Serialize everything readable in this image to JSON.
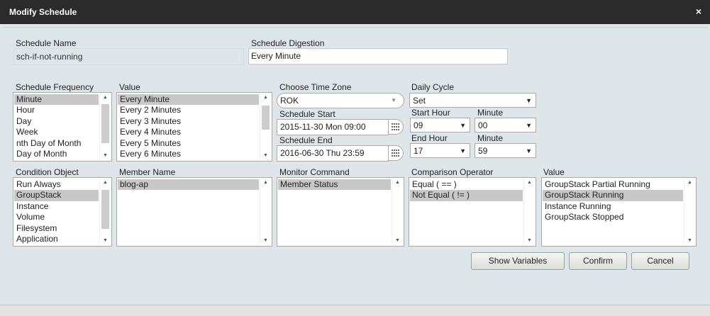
{
  "dialog": {
    "title": "Modify Schedule",
    "close_glyph": "×"
  },
  "schedule_name": {
    "label": "Schedule Name",
    "value": "sch-if-not-running"
  },
  "schedule_digestion": {
    "label": "Schedule Digestion",
    "value": "Every Minute"
  },
  "frequency": {
    "label": "Schedule Frequency",
    "items": [
      "Minute",
      "Hour",
      "Day",
      "Week",
      "nth Day of Month",
      "Day of Month"
    ],
    "selected": 0
  },
  "value_list": {
    "label": "Value",
    "items": [
      "Every Minute",
      "Every 2 Minutes",
      "Every 3 Minutes",
      "Every 4 Minutes",
      "Every 5 Minutes",
      "Every 6 Minutes"
    ],
    "selected": 0
  },
  "time_zone": {
    "label": "Choose Time Zone",
    "value": "ROK"
  },
  "schedule_start": {
    "label": "Schedule Start",
    "value": "2015-11-30 Mon 09:00"
  },
  "schedule_end": {
    "label": "Schedule End",
    "value": "2016-06-30 Thu 23:59"
  },
  "daily_cycle": {
    "label": "Daily Cycle",
    "value": "Set"
  },
  "start_hour": {
    "label": "Start Hour",
    "value": "09"
  },
  "start_minute": {
    "label": "Minute",
    "value": "00"
  },
  "end_hour": {
    "label": "End Hour",
    "value": "17"
  },
  "end_minute": {
    "label": "Minute",
    "value": "59"
  },
  "condition_object": {
    "label": "Condition Object",
    "items": [
      "Run Always",
      "GroupStack",
      "Instance",
      "Volume",
      "Filesystem",
      "Application"
    ],
    "selected": 1
  },
  "member_name": {
    "label": "Member Name",
    "items": [
      "blog-ap"
    ],
    "selected": 0
  },
  "monitor_command": {
    "label": "Monitor Command",
    "items": [
      "Member Status"
    ],
    "selected": 0
  },
  "comparison_operator": {
    "label": "Comparison Operator",
    "items": [
      "Equal ( == )",
      "Not Equal ( != )"
    ],
    "selected": 1
  },
  "value_list2": {
    "label": "Value",
    "items": [
      "GroupStack Partial Running",
      "GroupStack Running",
      "Instance Running",
      "GroupStack Stopped"
    ],
    "selected": 1
  },
  "buttons": {
    "show_variables": "Show Variables",
    "confirm": "Confirm",
    "cancel": "Cancel"
  }
}
